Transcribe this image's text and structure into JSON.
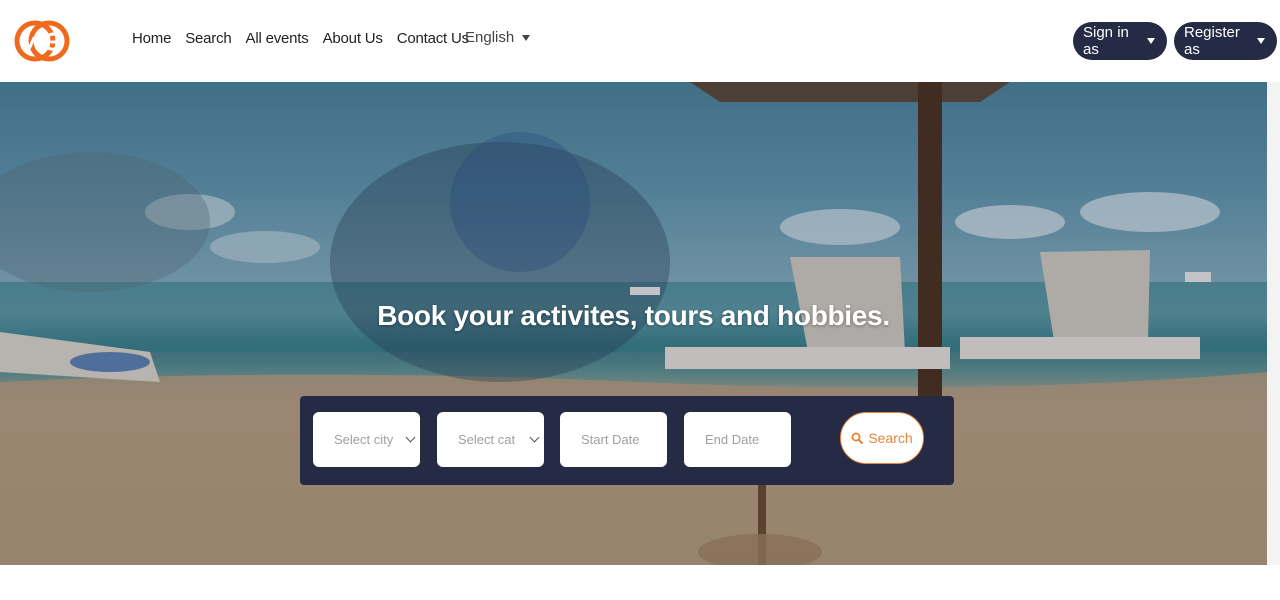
{
  "brand": {
    "logo_text": "WG",
    "logo_color": "#f06a1e"
  },
  "nav": {
    "items": [
      {
        "label": "Home"
      },
      {
        "label": "Search"
      },
      {
        "label": "All events"
      },
      {
        "label": "About Us"
      },
      {
        "label": "Contact Us"
      }
    ],
    "language": "English"
  },
  "auth": {
    "sign_in_label": "Sign in as",
    "register_label": "Register as"
  },
  "hero": {
    "headline": "Book your activites, tours and hobbies.",
    "search": {
      "city_placeholder": "Select city",
      "category_placeholder": "Select cat",
      "start_date_placeholder": "Start Date",
      "end_date_placeholder": "End Date",
      "button_label": "Search"
    }
  },
  "colors": {
    "navy": "#252a45",
    "accent": "#e8833a"
  },
  "icons": {
    "search": "search-icon",
    "dropdown": "caret-down-icon"
  }
}
